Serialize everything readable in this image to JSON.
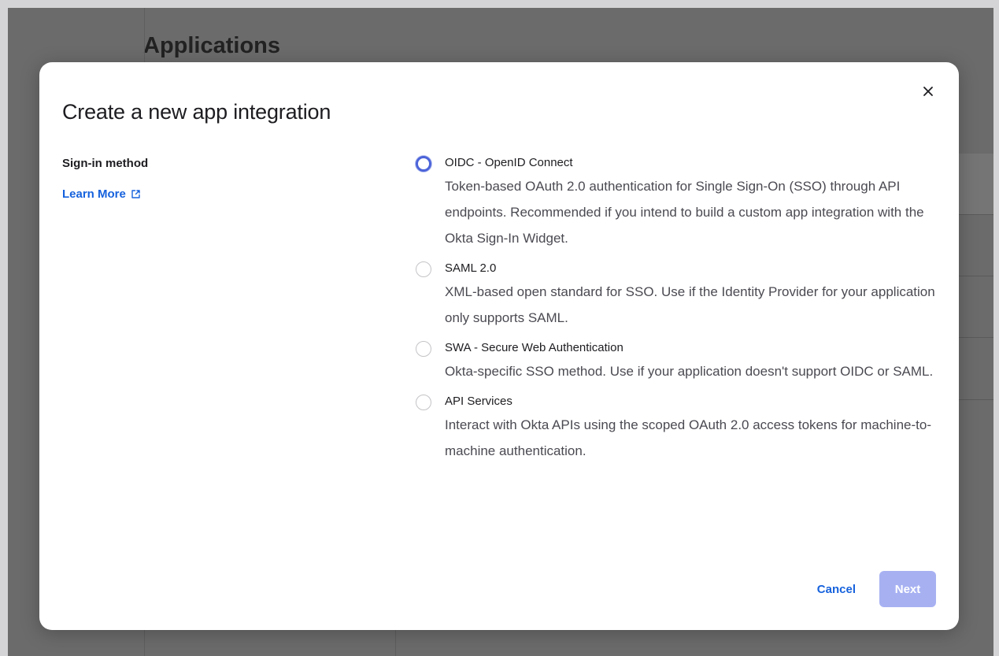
{
  "background": {
    "page_title": "Applications"
  },
  "modal": {
    "title": "Create a new app integration",
    "close_icon": "close-icon",
    "sign_in_label": "Sign-in method",
    "learn_more": "Learn More",
    "options": [
      {
        "label": "OIDC - OpenID Connect",
        "description": "Token-based OAuth 2.0 authentication for Single Sign-On (SSO) through API endpoints. Recommended if you intend to build a custom app integration with the Okta Sign-In Widget.",
        "selected": true
      },
      {
        "label": "SAML 2.0",
        "description": "XML-based open standard for SSO. Use if the Identity Provider for your application only supports SAML.",
        "selected": false
      },
      {
        "label": "SWA - Secure Web Authentication",
        "description": "Okta-specific SSO method. Use if your application doesn't support OIDC or SAML.",
        "selected": false
      },
      {
        "label": "API Services",
        "description": "Interact with Okta APIs using the scoped OAuth 2.0 access tokens for machine-to-machine authentication.",
        "selected": false
      }
    ],
    "cancel_label": "Cancel",
    "next_label": "Next"
  },
  "colors": {
    "accent": "#1662dd",
    "radio_selected": "#4c64d9",
    "next_disabled": "#a7b1f2",
    "overlay": "#6b6b6b"
  }
}
